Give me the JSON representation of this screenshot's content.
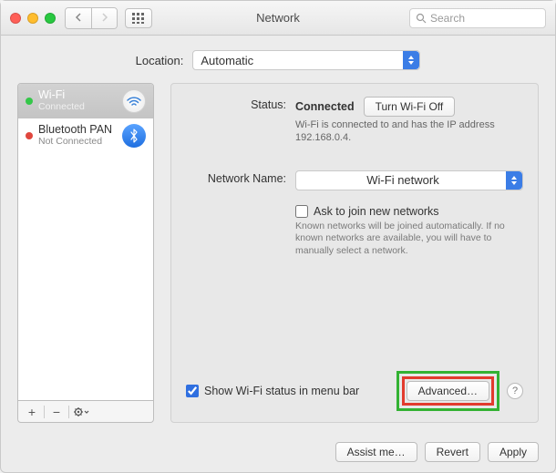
{
  "header": {
    "title": "Network",
    "search_placeholder": "Search"
  },
  "location": {
    "label": "Location:",
    "value": "Automatic"
  },
  "sidebar": {
    "items": [
      {
        "name": "Wi-Fi",
        "status": "Connected",
        "dot": "#34c749"
      },
      {
        "name": "Bluetooth PAN",
        "status": "Not Connected",
        "dot": "#e0473e"
      }
    ]
  },
  "main": {
    "status": {
      "label": "Status:",
      "value": "Connected",
      "toggle_btn": "Turn Wi-Fi Off",
      "detail": "Wi-Fi is connected to                and has the IP address 192.168.0.4."
    },
    "network_name": {
      "label": "Network Name:",
      "value": "Wi-Fi network"
    },
    "ask_join": {
      "label": "Ask to join new networks",
      "note": "Known networks will be joined automatically. If no known networks are available, you will have to manually select a network."
    },
    "show_menubar": "Show Wi-Fi status in menu bar",
    "advanced_btn": "Advanced…"
  },
  "footer": {
    "assist": "Assist me…",
    "revert": "Revert",
    "apply": "Apply"
  }
}
